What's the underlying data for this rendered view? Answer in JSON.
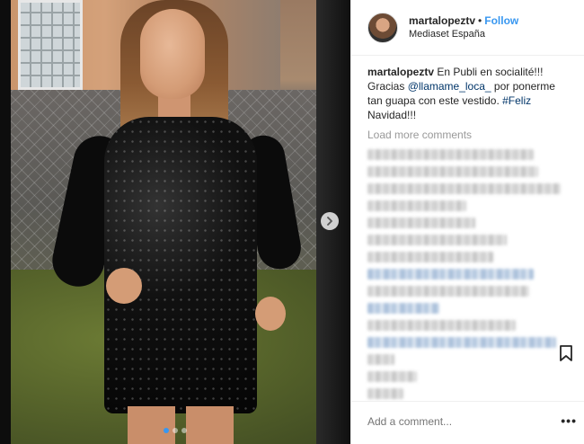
{
  "post": {
    "username": "martalopeztv",
    "separator": "•",
    "follow_label": "Follow",
    "location": "Mediaset España"
  },
  "caption": {
    "username": "martalopeztv",
    "text_1": " En Publi en socialité!!! Gracias ",
    "mention": "@llamame_loca_",
    "text_2": " por ponerme tan guapa con este vestido. ",
    "hashtag": "#Feliz",
    "text_3": " Navidad!!!"
  },
  "comments": {
    "load_more_label": "Load more comments"
  },
  "footer": {
    "add_comment_placeholder": "Add a comment...",
    "more_label": "•••"
  },
  "icons": {
    "next": "chevron-right-icon",
    "bookmark": "bookmark-icon"
  },
  "colors": {
    "link_blue": "#3897f0",
    "mention_blue": "#003569",
    "muted_gray": "#999999",
    "text": "#262626"
  },
  "carousel": {
    "active_index": 1,
    "total": 3
  }
}
